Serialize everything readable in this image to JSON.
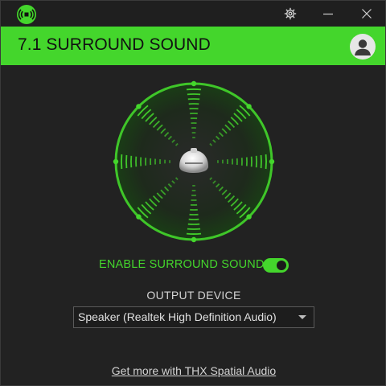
{
  "titlebar": {
    "logo_icon": "razer-sound-logo-icon",
    "settings_icon": "gear-icon",
    "minimize_icon": "minimize-icon",
    "close_icon": "close-icon"
  },
  "header": {
    "title": "7.1 SURROUND SOUND",
    "avatar_icon": "user-avatar-icon"
  },
  "surround": {
    "label": "ENABLE SURROUND SOUND",
    "enabled": true
  },
  "output": {
    "label": "OUTPUT DEVICE",
    "selected": "Speaker (Realtek High Definition Audio)"
  },
  "link": {
    "text": "Get more with THX Spatial Audio"
  },
  "colors": {
    "accent": "#44d62c",
    "background": "#222222",
    "titlebar": "#1f1f1f"
  }
}
